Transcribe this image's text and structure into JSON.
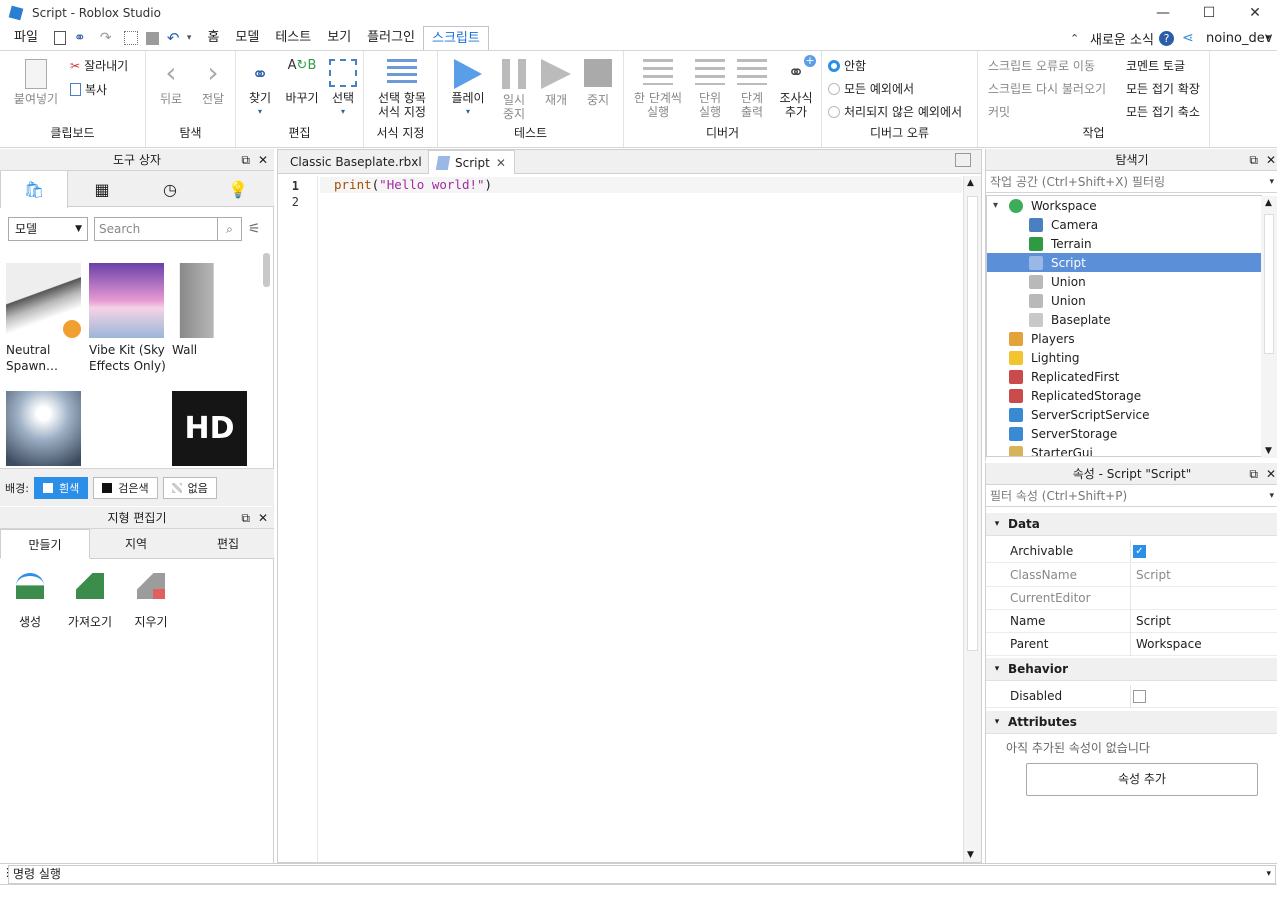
{
  "window": {
    "title": "Script - Roblox Studio",
    "minimize": "—",
    "maximize": "☐",
    "close": "✕"
  },
  "menu": {
    "items": [
      "파일",
      "홈",
      "모델",
      "테스트",
      "보기",
      "플러그인",
      "스크립트"
    ],
    "active": "스크립트",
    "right": {
      "news": "새로운 소식",
      "user": "noino_dev"
    }
  },
  "ribbon": {
    "clipboard": {
      "paste": "붙여넣기",
      "cut": "잘라내기",
      "copy": "복사",
      "label": "클립보드"
    },
    "navigate": {
      "back": "뒤로",
      "forward": "전달",
      "label": "탐색"
    },
    "edit": {
      "find": "찾기",
      "replace": "바꾸기",
      "select": "선택",
      "label": "편집"
    },
    "format": {
      "line1": "선택 항목",
      "line2": "서식 지정",
      "label": "서식 지정"
    },
    "test": {
      "play": "플레이",
      "pause1": "일시",
      "pause2": "중지",
      "resume": "재개",
      "stop": "중지",
      "label": "테스트"
    },
    "debugger": {
      "stepinto1": "한 단계씩",
      "stepinto2": "실행",
      "stepover1": "단위",
      "stepover2": "실행",
      "stepout1": "단계",
      "stepout2": "출력",
      "watch1": "조사식",
      "watch2": "추가",
      "label": "디버거"
    },
    "debug_errors": {
      "options": [
        "안함",
        "모든 예외에서",
        "처리되지 않은 예외에서"
      ],
      "selected": "안함",
      "label": "디버그 오류"
    },
    "actions": {
      "goto_error": "스크립트 오류로 이동",
      "reload": "스크립트 다시 불러오기",
      "commit": "커밋",
      "toggle_comment": "코멘트 토글",
      "expand_all": "모든 접기 확장",
      "collapse_all": "모든 접기 축소",
      "label": "작업"
    }
  },
  "toolbox": {
    "title": "도구 상자",
    "category": "모델",
    "search_placeholder": "Search",
    "items": [
      {
        "label": "Neutral Spawn…"
      },
      {
        "label": "Vibe Kit (Sky Effects Only)"
      },
      {
        "label": "Wall"
      },
      {
        "label": ""
      },
      {
        "label": ""
      },
      {
        "label": "HD"
      }
    ],
    "background_label": "배경:",
    "backgrounds": [
      "흰색",
      "검은색",
      "없음"
    ],
    "background_selected": "흰색"
  },
  "terrain": {
    "title": "지형 편집기",
    "tabs": [
      "만들기",
      "지역",
      "편집"
    ],
    "tools": [
      "생성",
      "가져오기",
      "지우기"
    ]
  },
  "editor": {
    "tabs": [
      {
        "label": "Classic Baseplate.rbxl"
      },
      {
        "label": "Script"
      }
    ],
    "lines": [
      "1",
      "2"
    ],
    "code_fn": "print",
    "code_open": "(",
    "code_str": "\"Hello world!\"",
    "code_close": ")"
  },
  "explorer": {
    "title": "탐색기",
    "filter": "작업 공간 (Ctrl+Shift+X) 필터링",
    "nodes": [
      {
        "label": "Workspace",
        "color": "#3cae5a"
      },
      {
        "label": "Camera",
        "color": "#4a7fc1"
      },
      {
        "label": "Terrain",
        "color": "#2e9b42"
      },
      {
        "label": "Script",
        "color": "#9ab8e6"
      },
      {
        "label": "Union",
        "color": "#b9b9b9"
      },
      {
        "label": "Union",
        "color": "#b9b9b9"
      },
      {
        "label": "Baseplate",
        "color": "#c8c8c8"
      },
      {
        "label": "Players",
        "color": "#e3a23a"
      },
      {
        "label": "Lighting",
        "color": "#f2c530"
      },
      {
        "label": "ReplicatedFirst",
        "color": "#c94b4b"
      },
      {
        "label": "ReplicatedStorage",
        "color": "#c94b4b"
      },
      {
        "label": "ServerScriptService",
        "color": "#3a8ad3"
      },
      {
        "label": "ServerStorage",
        "color": "#3a8ad3"
      },
      {
        "label": "StarterGui",
        "color": "#d9b35a"
      }
    ],
    "selected": "Script"
  },
  "properties": {
    "title": "속성 - Script \"Script\"",
    "filter": "필터 속성 (Ctrl+Shift+P)",
    "sections": {
      "data": "Data",
      "behavior": "Behavior",
      "attributes": "Attributes"
    },
    "rows": {
      "archivable": "Archivable",
      "classname": "ClassName",
      "classname_val": "Script",
      "currenteditor": "CurrentEditor",
      "name": "Name",
      "name_val": "Script",
      "parent": "Parent",
      "parent_val": "Workspace",
      "disabled": "Disabled"
    },
    "archivable_checked": true,
    "disabled_checked": false,
    "no_attributes": "아직 추가된 속성이 없습니다",
    "add_attribute": "속성 추가"
  },
  "command_bar": {
    "placeholder": "명령 실행"
  }
}
